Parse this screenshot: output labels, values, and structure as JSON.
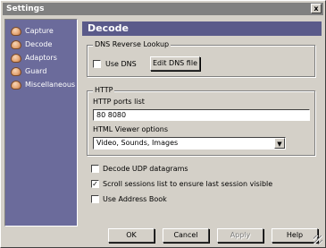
{
  "window": {
    "title": "Settings",
    "close_glyph": "x"
  },
  "sidebar": {
    "items": [
      {
        "label": "Capture",
        "icon": "settings-category-icon"
      },
      {
        "label": "Decode",
        "icon": "settings-category-icon"
      },
      {
        "label": "Adaptors",
        "icon": "settings-category-icon"
      },
      {
        "label": "Guard",
        "icon": "settings-category-icon"
      },
      {
        "label": "Miscellaneous",
        "icon": "settings-category-icon"
      }
    ]
  },
  "page": {
    "title": "Decode"
  },
  "dns": {
    "legend": "DNS Reverse Lookup",
    "use_dns_label": "Use DNS",
    "use_dns_checked": false,
    "edit_button": "Edit DNS file"
  },
  "http": {
    "legend": "HTTP",
    "ports_label": "HTTP ports list",
    "ports_value": "80 8080",
    "viewer_label": "HTML Viewer options",
    "viewer_value": "Video, Sounds, Images",
    "dropdown_glyph": "▼"
  },
  "options": {
    "decode_udp_label": "Decode UDP datagrams",
    "decode_udp_checked": false,
    "scroll_label": "Scroll sessions list to ensure last session visible",
    "scroll_checked": true,
    "address_book_label": "Use Address Book",
    "address_book_checked": false,
    "check_glyph": "✓"
  },
  "buttons": {
    "ok": "OK",
    "cancel": "Cancel",
    "apply": "Apply",
    "help": "Help"
  },
  "colors": {
    "sidebar_bg": "#6b6b9b",
    "header_bg": "#5a5a8a",
    "titlebar_bg": "#808080"
  }
}
